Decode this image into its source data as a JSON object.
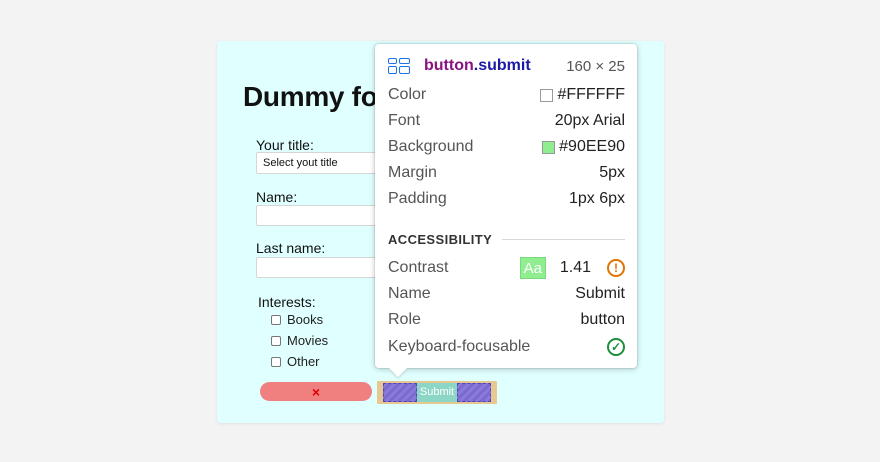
{
  "page": {
    "title": "Dummy fo",
    "fields": {
      "title_label": "Your title:",
      "title_select_value": "Select yout title",
      "name_label": "Name:",
      "last_name_label": "Last name:",
      "interests_label": "Interests:",
      "interests": [
        "Books",
        "Movies",
        "Other"
      ]
    },
    "reset_icon": "×",
    "submit_label": "Submit"
  },
  "tooltip": {
    "tag": "button",
    "class": ".submit",
    "size": "160 × 25",
    "icon": "grid-layout-icon",
    "rows": {
      "color": {
        "label": "Color",
        "value": "#FFFFFF",
        "swatch": "#FFFFFF"
      },
      "font": {
        "label": "Font",
        "value": "20px Arial"
      },
      "background": {
        "label": "Background",
        "value": "#90EE90",
        "swatch": "#90EE90"
      },
      "margin": {
        "label": "Margin",
        "value": "5px"
      },
      "padding": {
        "label": "Padding",
        "value": "1px 6px"
      }
    },
    "accessibility": {
      "title": "ACCESSIBILITY",
      "contrast": {
        "label": "Contrast",
        "badge": "Aa",
        "value": "1.41",
        "status_icon": "warning-icon"
      },
      "name": {
        "label": "Name",
        "value": "Submit"
      },
      "role": {
        "label": "Role",
        "value": "button"
      },
      "keyboard": {
        "label": "Keyboard-focusable",
        "status_icon": "check-circle-icon"
      }
    }
  },
  "colors": {
    "card_bg": "#E0FFFF",
    "reset_bg": "#F08080",
    "accent_blue": "#1A73E8",
    "warning": "#E37400",
    "ok": "#1E8E3E"
  }
}
